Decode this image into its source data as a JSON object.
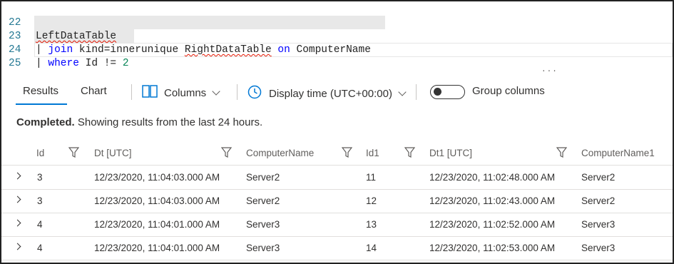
{
  "editor": {
    "lines": [
      {
        "number": "22",
        "text": "LeftDataTable"
      },
      {
        "number": "23",
        "pipe": "| ",
        "kw1": "join",
        "mid": " kind=innerunique ",
        "ident": "RightDataTable",
        "kw2": " on",
        "tail": " ComputerName"
      },
      {
        "number": "24",
        "pipe": "| ",
        "kw1": "where",
        "mid": " Id != ",
        "num": "2"
      },
      {
        "number": "25",
        "text": ""
      }
    ],
    "more": "..."
  },
  "toolbar": {
    "tabs": [
      {
        "label": "Results",
        "selected": true
      },
      {
        "label": "Chart",
        "selected": false
      }
    ],
    "columns_label": "Columns",
    "display_time_label": "Display time (UTC+00:00)",
    "group_columns_label": "Group columns",
    "group_columns_on": false
  },
  "status": {
    "bold": "Completed.",
    "text": " Showing results from the last 24 hours."
  },
  "table": {
    "columns": [
      "Id",
      "Dt [UTC]",
      "ComputerName",
      "Id1",
      "Dt1 [UTC]",
      "ComputerName1"
    ],
    "rows": [
      [
        "3",
        "12/23/2020, 11:04:03.000 AM",
        "Server2",
        "11",
        "12/23/2020, 11:02:48.000 AM",
        "Server2"
      ],
      [
        "3",
        "12/23/2020, 11:04:03.000 AM",
        "Server2",
        "12",
        "12/23/2020, 11:02:43.000 AM",
        "Server2"
      ],
      [
        "4",
        "12/23/2020, 11:04:01.000 AM",
        "Server3",
        "13",
        "12/23/2020, 11:02:52.000 AM",
        "Server3"
      ],
      [
        "4",
        "12/23/2020, 11:04:01.000 AM",
        "Server3",
        "14",
        "12/23/2020, 11:02:53.000 AM",
        "Server3"
      ]
    ]
  },
  "colors": {
    "accent": "#0078d4",
    "keyword": "#0000ff",
    "number": "#098658",
    "line_number": "#237893"
  }
}
